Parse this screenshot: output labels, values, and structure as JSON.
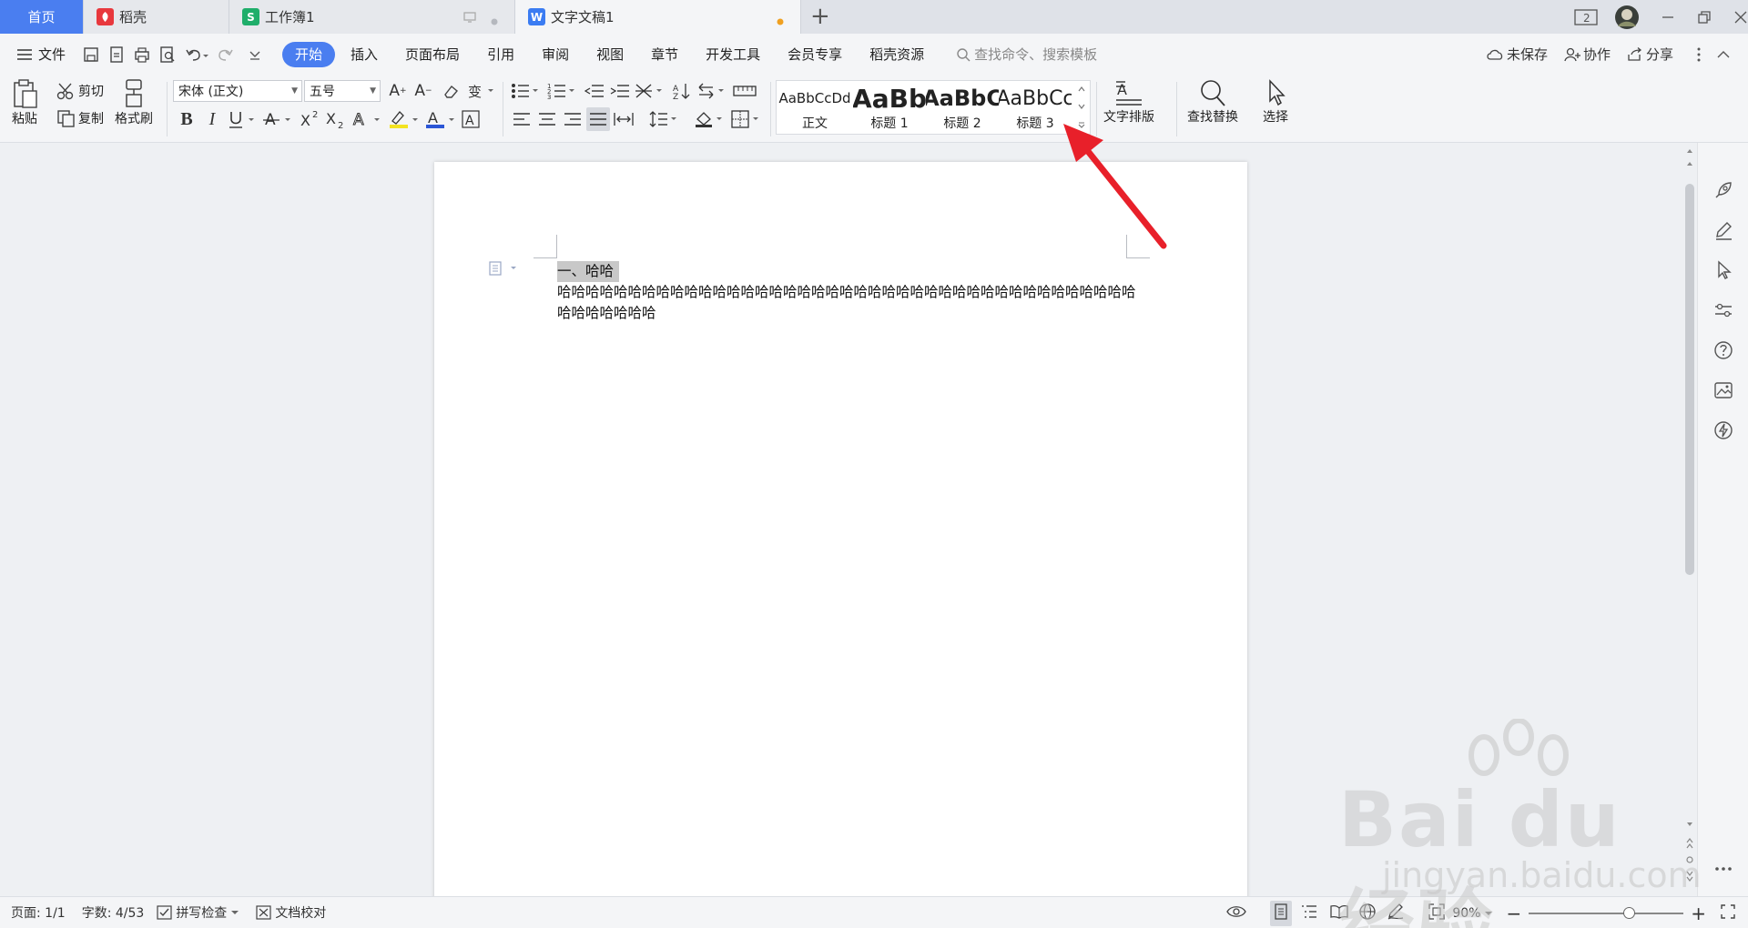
{
  "tabs": [
    {
      "label": "首页"
    },
    {
      "label": "稻壳"
    },
    {
      "label": "工作簿1"
    },
    {
      "label": "文字文稿1"
    }
  ],
  "window": {
    "badge": "2"
  },
  "menu": {
    "file_label": "文件",
    "items": [
      "开始",
      "插入",
      "页面布局",
      "引用",
      "审阅",
      "视图",
      "章节",
      "开发工具",
      "会员专享",
      "稻壳资源"
    ],
    "search_placeholder": "查找命令、搜索模板",
    "unsaved": "未保存",
    "collab": "协作",
    "share": "分享"
  },
  "ribbon": {
    "paste": "粘贴",
    "cut": "剪切",
    "copy": "复制",
    "format_painter": "格式刷",
    "font_name": "宋体 (正文)",
    "font_size": "五号",
    "styles": [
      {
        "sample": "AaBbCcDd",
        "name": "正文"
      },
      {
        "sample": "AaBb",
        "name": "标题 1"
      },
      {
        "sample": "AaBbC",
        "name": "标题 2"
      },
      {
        "sample": "AaBbCc",
        "name": "标题 3"
      }
    ],
    "text_layout": "文字排版",
    "find_replace": "查找替换",
    "select": "选择"
  },
  "document": {
    "heading": "一、哈哈",
    "paragraph": "哈哈哈哈哈哈哈哈哈哈哈哈哈哈哈哈哈哈哈哈哈哈哈哈哈哈哈哈哈哈哈哈哈哈哈哈哈哈哈哈哈哈哈哈哈哈哈哈"
  },
  "status": {
    "page": "页面: 1/1",
    "words": "字数: 4/53",
    "spell": "拼写检查",
    "proof": "文档校对",
    "zoom": "90%"
  },
  "watermark": {
    "brand": "Bai du 经验",
    "url": "jingyan.baidu.com"
  },
  "colors": {
    "accent": "#4a7ef0",
    "arrow": "#e8202a"
  }
}
